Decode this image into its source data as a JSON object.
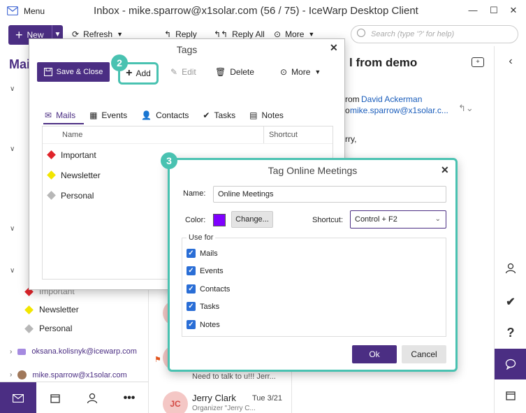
{
  "window": {
    "menu_label": "Menu",
    "title": "Inbox - mike.sparrow@x1solar.com (56 / 75) - IceWarp Desktop Client",
    "minimize": "—",
    "maximize": "☐",
    "close": "✕"
  },
  "toolbar": {
    "new_label": "New",
    "refresh_label": "Refresh",
    "reply_label": "Reply",
    "reply_all_label": "Reply All",
    "more_label": "More",
    "search_placeholder": "Search (type '?' for help)"
  },
  "sidebar": {
    "heading": "Mai",
    "tag_items": [
      {
        "label": "Important",
        "color": "#e0242b"
      },
      {
        "label": "Newsletter",
        "color": "#f2e600"
      },
      {
        "label": "Personal",
        "color": "#b7b7b7"
      }
    ],
    "accounts": [
      {
        "label": "oksana.kolisnyk@icewarp.com"
      },
      {
        "label": "mike.sparrow@x1solar.com"
      }
    ]
  },
  "message_list": {
    "snippet_line": "Need to talk to u!!! Jerr...",
    "item": {
      "initials": "JC",
      "sender": "Jerry Clark",
      "date": "Tue 3/21",
      "preview": "Organizer \"Jerry C..."
    }
  },
  "reading_pane": {
    "subject": "l from demo",
    "from_prefix": "rom",
    "from_name": "David Ackerman",
    "to_prefix": "o",
    "to_value": "mike.sparrow@x1solar.c...",
    "body_fragment": "rry,"
  },
  "tags_dialog": {
    "title": "Tags",
    "save_close_label": "Save & Close",
    "add_label": "Add",
    "edit_label": "Edit",
    "delete_label": "Delete",
    "more_label": "More",
    "step_badge": "2",
    "tabs": [
      {
        "label": "Mails"
      },
      {
        "label": "Events"
      },
      {
        "label": "Contacts"
      },
      {
        "label": "Tasks"
      },
      {
        "label": "Notes"
      }
    ],
    "columns": {
      "name": "Name",
      "shortcut": "Shortcut"
    },
    "rows": [
      {
        "name": "Important",
        "color": "#e0242b"
      },
      {
        "name": "Newsletter",
        "color": "#f2e600"
      },
      {
        "name": "Personal",
        "color": "#b7b7b7"
      }
    ]
  },
  "tag_dialog": {
    "title": "Tag Online Meetings",
    "step_badge": "3",
    "name_label": "Name:",
    "name_value": "Online Meetings",
    "color_label": "Color:",
    "color_value": "#7f00ff",
    "change_label": "Change...",
    "shortcut_label": "Shortcut:",
    "shortcut_value": "Control + F2",
    "use_for_label": "Use for",
    "use_for": [
      {
        "label": "Mails",
        "checked": true
      },
      {
        "label": "Events",
        "checked": true
      },
      {
        "label": "Contacts",
        "checked": true
      },
      {
        "label": "Tasks",
        "checked": true
      },
      {
        "label": "Notes",
        "checked": true
      }
    ],
    "ok_label": "Ok",
    "cancel_label": "Cancel"
  }
}
